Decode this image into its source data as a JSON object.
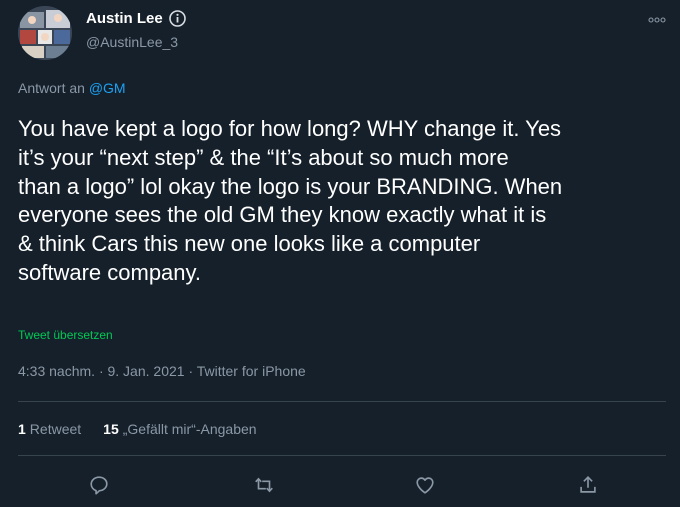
{
  "author": {
    "display_name": "Austin Lee",
    "handle": "@AustinLee_3"
  },
  "reply": {
    "prefix": "Antwort an",
    "mention": "@GM"
  },
  "tweet": {
    "text": "You have kept a logo for how long? WHY change it. Yes\nit’s your “next step” & the “It’s about so much more\nthan a logo” lol okay the logo is your BRANDING. When\neveryone sees the old GM they know exactly what it is\n& think Cars this new one looks like a computer\nsoftware company.",
    "translate_label": "Tweet übersetzen",
    "meta": "4:33 nachm. · 9. Jan. 2021 · Twitter for iPhone"
  },
  "stats": {
    "retweets_count": "1",
    "retweets_label": "Retweet",
    "likes_count": "15",
    "likes_label": "„Gefällt mir“-Angaben"
  },
  "colors": {
    "background": "#15202b",
    "accent": "#1da1f2",
    "translate": "#00c853",
    "muted": "#8b98a5"
  },
  "icons": [
    "info-icon",
    "more-icon",
    "reply-icon",
    "retweet-icon",
    "like-icon",
    "share-icon"
  ]
}
